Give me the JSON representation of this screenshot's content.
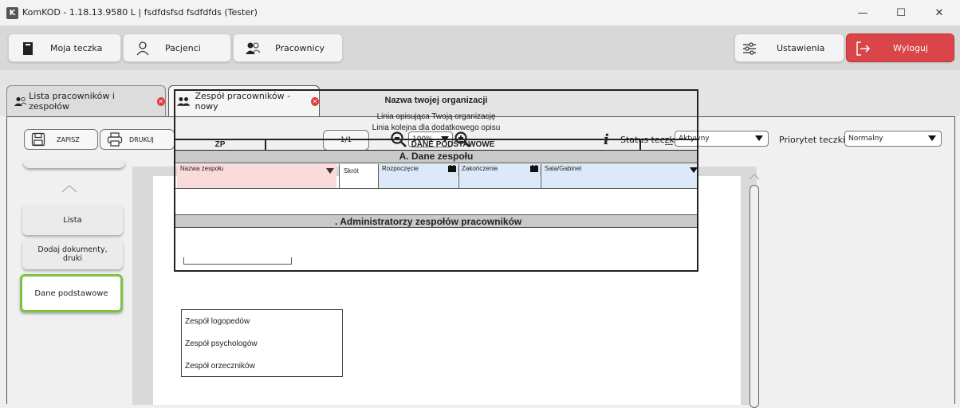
{
  "window": {
    "title": "KomKOD - 1.18.13.9580 L | fsdfdsfsd fsdfdfds (Tester)",
    "logo_letter": "K",
    "minimize": "—",
    "maximize": "☐",
    "close": "✕"
  },
  "nav": {
    "moja_teczka": "Moja teczka",
    "pacjenci": "Pacjenci",
    "pracownicy": "Pracownicy",
    "ustawienia": "Ustawienia",
    "wyloguj": "Wyloguj"
  },
  "tabs": [
    {
      "label": "Lista pracowników i zespołów",
      "active": false
    },
    {
      "label": "Zespół pracowników - nowy",
      "active": true
    }
  ],
  "toolbar": {
    "save": "ZAPISZ",
    "print": "DRUKUJ",
    "page": "1/1",
    "zoom": "100%",
    "status_label": "Status teczki",
    "status_value": "Aktywny",
    "priority_label": "Priorytet teczki:",
    "priority_value": "Normalny"
  },
  "sidebar": {
    "items": [
      {
        "label": "Lista"
      },
      {
        "label": "Dodaj dokumenty, druki"
      },
      {
        "label": "Dane podstawowe"
      }
    ]
  },
  "form": {
    "org_name": "Nazwa twojej organizacji",
    "line1": "Linia opisująca Twoją organizację",
    "line2": "Linia kolejna dla dodatkowego opisu",
    "zp": "ZP",
    "header_title": "DANE PODSTAWOWE",
    "header_right": "---",
    "section_a": "A. Dane zespołu",
    "field_name": "Nazwa zespołu",
    "field_short": "Skrót",
    "field_start": "Rozpoczęcie",
    "field_end": "Zakończenie",
    "field_room": "Sala/Gabinet",
    "section_b": ". Administratorzy zespołów pracowników",
    "dropdown": [
      "Zespół logopedów",
      "Zespół psychologów",
      "Zespół orzeczników"
    ]
  },
  "colors": {
    "accent_green": "#7dc242",
    "logout_red": "#d94548",
    "field_pink": "#fadada",
    "field_blue": "#dbe9f8",
    "section_gray": "#c9c9c9"
  }
}
